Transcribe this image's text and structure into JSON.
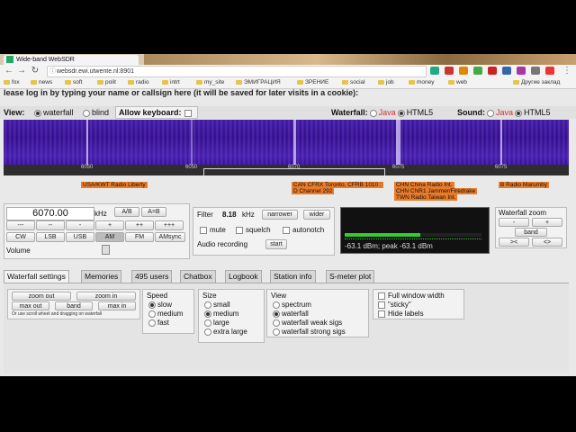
{
  "browser": {
    "tab_title": "Wide-band WebSDR",
    "url": "websdr.ewi.utwente.nl:8901",
    "bookmarks": [
      "fox",
      "news",
      "soft",
      "polit",
      "radio",
      "intrt",
      "my_site",
      "ЭМИГРАЦИЯ",
      "ЗРЕНИЕ",
      "social",
      "job",
      "money",
      "web"
    ],
    "other_bookmarks": "Другие заклад"
  },
  "login_prompt": "lease log in by typing your name or callsign here (it will be saved for later visits in a cookie):",
  "view": {
    "label": "View:",
    "options": [
      "waterfall",
      "blind"
    ],
    "selected": "waterfall",
    "allow_keyboard": "Allow keyboard:"
  },
  "waterfall_mode": {
    "label": "Waterfall:",
    "java": "Java",
    "html5": "HTML5"
  },
  "sound_mode": {
    "label": "Sound:",
    "java": "Java",
    "html5": "HTML5"
  },
  "scale_ticks": [
    "6050",
    "6070",
    "6075"
  ],
  "stations": [
    "USA/KWT Radio Liberty",
    "CAN CFRX Toronto, CFRB 1010 :",
    "D Channel 292",
    "CHN China Radio Int.",
    "CHN CNR1 Jammer/Firedrake",
    "TWN Radio Taiwan Int.",
    "B Radio Marumby"
  ],
  "tuning": {
    "frequency": "6070.00",
    "unit": "kHz",
    "ab": "A/B",
    "aeqb": "A=B",
    "step_buttons": [
      "---",
      "--",
      "-",
      "+",
      "++",
      "+++"
    ],
    "modes": [
      "CW",
      "LSB",
      "USB",
      "AM",
      "FM",
      "AMsync"
    ],
    "selected_mode": "AM",
    "volume_label": "Volume"
  },
  "filter": {
    "label": "Filter",
    "value": "8.18",
    "unit": "kHz",
    "narrower": "narrower",
    "wider": "wider",
    "mute": "mute",
    "squelch": "squelch",
    "autonotch": "autonotch",
    "audio_recording": "Audio recording",
    "start": "start"
  },
  "smeter": {
    "reading": "-63.1 dBm; peak -63.1 dBm",
    "level": 0.55
  },
  "zoom": {
    "label": "Waterfall zoom",
    "minus": "-",
    "plus": "+",
    "band": "band",
    "left": "><",
    "right": "<>"
  },
  "tabs": [
    "Waterfall settings",
    "Memories",
    "495 users",
    "Chatbox",
    "Logbook",
    "Station info",
    "S-meter plot"
  ],
  "active_tab": "Waterfall settings",
  "settings": {
    "zoom_out": "zoom out",
    "zoom_in": "zoom in",
    "max_out": "max out",
    "band": "band",
    "max_in": "max in",
    "hint": "Or use scroll wheel and dragging on waterfall",
    "speed_label": "Speed",
    "speed_options": [
      "slow",
      "medium",
      "fast"
    ],
    "speed_selected": "slow",
    "size_label": "Size",
    "size_options": [
      "small",
      "medium",
      "large",
      "extra large"
    ],
    "size_selected": "medium",
    "view_label": "View",
    "view_options": [
      "spectrum",
      "waterfall",
      "waterfall weak sigs",
      "waterfall strong sigs"
    ],
    "view_selected": "waterfall",
    "checks": [
      "Full window width",
      "\"sticky\"",
      "Hide labels"
    ]
  }
}
